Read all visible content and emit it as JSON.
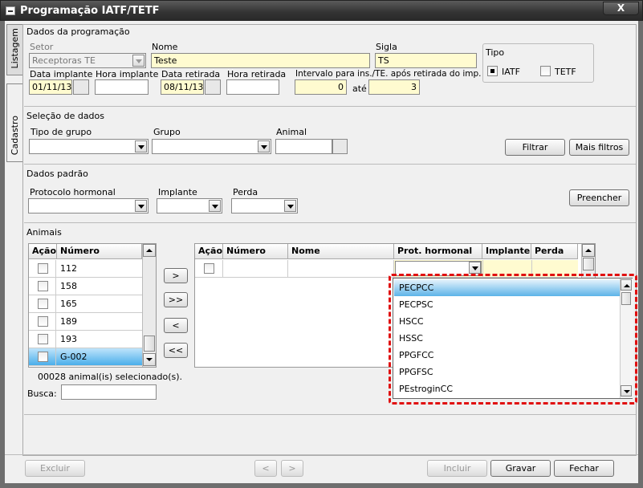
{
  "window": {
    "title": "Programação IATF/TETF",
    "close_label": "X"
  },
  "tabs": [
    {
      "label": "Listagem"
    },
    {
      "label": "Cadastro"
    }
  ],
  "dados_programacao": {
    "title": "Dados da programação",
    "setor_label": "Setor",
    "setor_value": "Receptoras TE",
    "nome_label": "Nome",
    "nome_value": "Teste",
    "sigla_label": "Sigla",
    "sigla_value": "TS",
    "data_implante_label": "Data implante",
    "data_implante_value": "01/11/13",
    "hora_implante_label": "Hora implante",
    "data_retirada_label": "Data retirada",
    "data_retirada_value": "08/11/13",
    "hora_retirada_label": "Hora retirada",
    "intervalo_label": "Intervalo para ins./TE. após retirada do imp.",
    "intervalo_de": "0",
    "ate_label": "até",
    "intervalo_ate": "3",
    "tipo_label": "Tipo",
    "iatf_label": "IATF",
    "tetf_label": "TETF"
  },
  "selecao_dados": {
    "title": "Seleção de dados",
    "tipo_grupo_label": "Tipo de grupo",
    "grupo_label": "Grupo",
    "animal_label": "Animal",
    "filtrar_label": "Filtrar",
    "mais_filtros_label": "Mais filtros"
  },
  "dados_padrao": {
    "title": "Dados padrão",
    "protocolo_label": "Protocolo hormonal",
    "implante_label": "Implante",
    "perda_label": "Perda",
    "preencher_label": "Preencher"
  },
  "animais": {
    "title": "Animais",
    "left_grid": {
      "col_acao": "Ação",
      "col_numero": "Número",
      "rows": [
        "112",
        "158",
        "165",
        "189",
        "193",
        "G-002"
      ]
    },
    "selected_count_text": "00028 animal(is) selecionado(s).",
    "busca_label": "Busca:",
    "move_buttons": [
      ">",
      ">>",
      "<",
      "<<"
    ],
    "right_grid": {
      "col_acao": "Ação",
      "col_numero": "Número",
      "col_nome": "Nome",
      "col_prot": "Prot. hormonal",
      "col_implante": "Implante",
      "col_perda": "Perda"
    },
    "dropdown_options": [
      "PECPCC",
      "PECPSC",
      "HSCC",
      "HSSC",
      "PPGFCC",
      "PPGFSC",
      "PEstroginCC"
    ]
  },
  "footer": {
    "excluir_label": "Excluir",
    "prev_label": "<",
    "next_label": ">",
    "incluir_label": "Incluir",
    "gravar_label": "Gravar",
    "fechar_label": "Fechar"
  },
  "colors": {
    "highlight": "#e01010",
    "selection": "#4aaeea",
    "yellow_field": "#fffbd0"
  }
}
